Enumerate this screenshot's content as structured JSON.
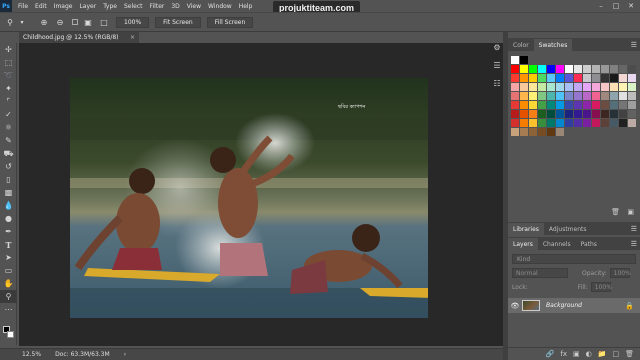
{
  "app": {
    "logo": "Ps"
  },
  "menu": [
    "File",
    "Edit",
    "Image",
    "Layer",
    "Type",
    "Select",
    "Filter",
    "3D",
    "View",
    "Window",
    "Help"
  ],
  "window_controls": [
    "minimize-icon",
    "maximize-icon",
    "close-icon"
  ],
  "watermark": "projuktiteam.com",
  "options_bar": {
    "zoom_value": "100%",
    "fit_screen": "Fit Screen",
    "fill_screen": "Fill Screen"
  },
  "document_tab": {
    "title": "Childhood.jpg @ 12.5% (RGB/8)",
    "close": "×"
  },
  "photo_caption": "ছবির ক্যাপশন",
  "status": {
    "zoom": "12.5%",
    "doc": "Doc: 63.3M/63.3M",
    "arrow": "›"
  },
  "color_panel": {
    "tabs": [
      "Color",
      "Swatches"
    ],
    "active_tab": "Swatches"
  },
  "libraries_panel": {
    "tabs": [
      "Libraries",
      "Adjustments"
    ]
  },
  "layers_panel": {
    "tabs": [
      "Layers",
      "Channels",
      "Paths"
    ],
    "search_placeholder": "Kind",
    "blend_mode": "Normal",
    "opacity_label": "Opacity:",
    "opacity_value": "100%",
    "lock_label": "Lock:",
    "fill_label": "Fill:",
    "fill_value": "100%",
    "layers": [
      {
        "name": "Background",
        "visible": true,
        "locked": true
      }
    ]
  },
  "colors": {
    "swatch_rows": [
      [
        "#ffffff",
        "#000000"
      ],
      [
        "#ff0000",
        "#ffff00",
        "#00ff00",
        "#00ffff",
        "#0000ff",
        "#ff00ff",
        "#ffffff",
        "#e6e6e6",
        "#cccccc",
        "#b3b3b3",
        "#999999",
        "#808080",
        "#666666",
        "#4d4d4d"
      ],
      [
        "#ff3b30",
        "#ff9500",
        "#ffcc00",
        "#4cd964",
        "#5ac8fa",
        "#007aff",
        "#5856d6",
        "#ff2d55",
        "#c7c7cc",
        "#8e8e93",
        "#333333",
        "#1a1a1a",
        "#f2d7d5",
        "#e8d8f0"
      ],
      [
        "#f5a5a5",
        "#f9c99b",
        "#fde89a",
        "#c4eaa2",
        "#a8e6cf",
        "#9fd8ef",
        "#a7bff5",
        "#c2a7f5",
        "#e5a7f5",
        "#f5a7d9",
        "#f7c6c6",
        "#ffe0b3",
        "#fff3b3",
        "#d9f2c6"
      ],
      [
        "#e57373",
        "#ffb74d",
        "#fff176",
        "#81c784",
        "#4db6ac",
        "#4fc3f7",
        "#7986cb",
        "#9575cd",
        "#ba68c8",
        "#f06292",
        "#a1887f",
        "#90a4ae",
        "#e0e0e0",
        "#bdbdbd"
      ],
      [
        "#e53935",
        "#fb8c00",
        "#fdd835",
        "#43a047",
        "#00897b",
        "#039be5",
        "#3949ab",
        "#5e35b1",
        "#8e24aa",
        "#d81b60",
        "#6d4c41",
        "#546e7a",
        "#757575",
        "#9e9e9e"
      ],
      [
        "#b71c1c",
        "#e65100",
        "#f57f17",
        "#1b5e20",
        "#004d40",
        "#01579b",
        "#1a237e",
        "#311b92",
        "#4a148c",
        "#880e4f",
        "#3e2723",
        "#263238",
        "#424242",
        "#616161"
      ],
      [
        "#d32f2f",
        "#f57c00",
        "#fbc02d",
        "#388e3c",
        "#00796b",
        "#0288d1",
        "#303f9f",
        "#512da8",
        "#7b1fa2",
        "#c2185b",
        "#5d4037",
        "#455a64",
        "#212121",
        "#bcaaa4"
      ],
      [
        "#c8a27a",
        "#a67c52",
        "#8c6239",
        "#754c24",
        "#603913",
        "#998675"
      ]
    ]
  },
  "tools": [
    "move-icon",
    "marquee-icon",
    "lasso-icon",
    "quick-select-icon",
    "crop-icon",
    "eyedropper-icon",
    "healing-icon",
    "brush-icon",
    "stamp-icon",
    "history-brush-icon",
    "eraser-icon",
    "gradient-icon",
    "blur-icon",
    "dodge-icon",
    "pen-icon",
    "type-icon",
    "path-select-icon",
    "rectangle-icon",
    "hand-icon",
    "zoom-icon"
  ]
}
